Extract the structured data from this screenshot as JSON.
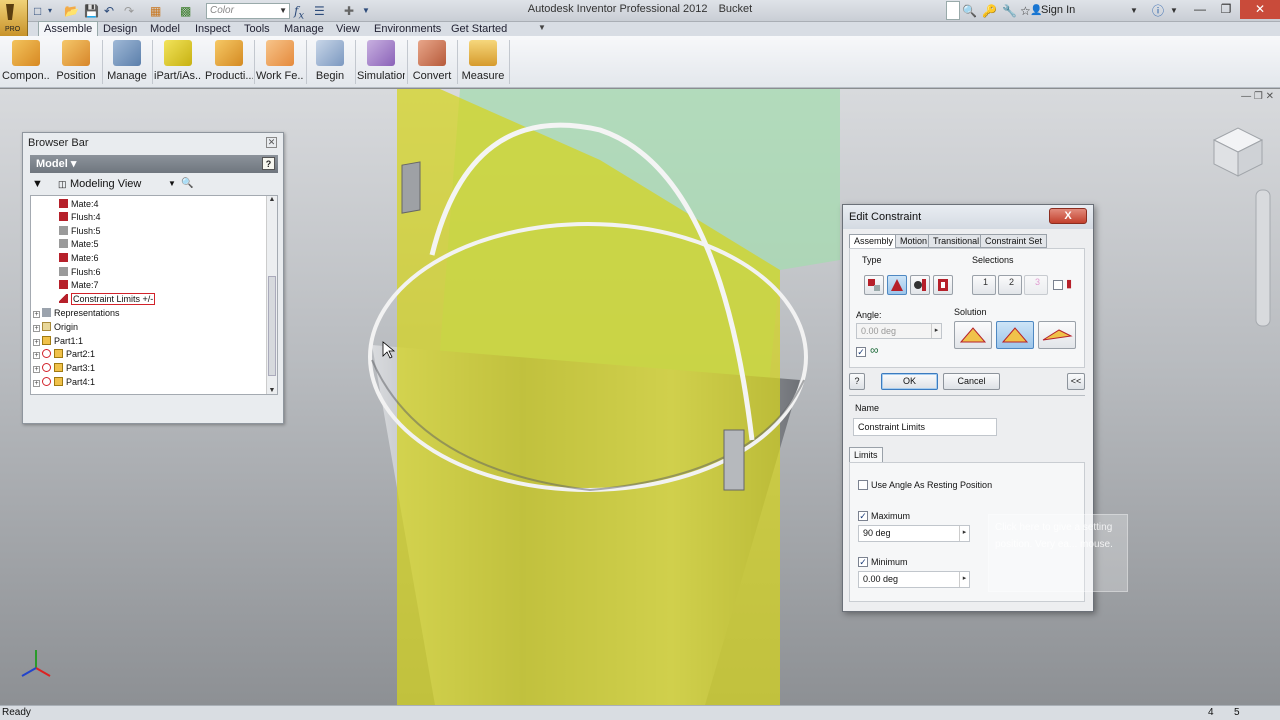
{
  "window": {
    "app_title": "Autodesk Inventor Professional 2012",
    "doc_title": "Bucket",
    "signin": "Sign In",
    "color_placeholder": "Color"
  },
  "app_button": {
    "badge": "PRO"
  },
  "menu_tabs": [
    {
      "label": "Assemble",
      "active": true
    },
    {
      "label": "Design"
    },
    {
      "label": "Model"
    },
    {
      "label": "Inspect"
    },
    {
      "label": "Tools"
    },
    {
      "label": "Manage"
    },
    {
      "label": "View"
    },
    {
      "label": "Environments"
    },
    {
      "label": "Get Started"
    }
  ],
  "ribbon": [
    {
      "label": "Compon...",
      "icon": "component-icon",
      "color": "#e8a33a"
    },
    {
      "label": "Position",
      "icon": "position-icon",
      "color": "#e8a33a"
    },
    {
      "label": "Manage",
      "icon": "manage-icon",
      "color": "#6e8fb8"
    },
    {
      "label": "iPart/iAs...",
      "icon": "ipart-icon",
      "color": "#d8c21a"
    },
    {
      "label": "Producti...",
      "icon": "productivity-icon",
      "color": "#e8a33a"
    },
    {
      "label": "Work Fe...",
      "icon": "work-features-icon",
      "color": "#f0a060"
    },
    {
      "label": "Begin",
      "icon": "begin-icon",
      "color": "#8aa6c9"
    },
    {
      "label": "Simulation",
      "icon": "simulation-icon",
      "color": "#9a72c0"
    },
    {
      "label": "Convert",
      "icon": "convert-icon",
      "color": "#c46a4a"
    },
    {
      "label": "Measure",
      "icon": "measure-icon",
      "color": "#d9a23a"
    }
  ],
  "browser": {
    "title": "Browser Bar",
    "model_label": "Model ▾",
    "help": "?",
    "view_label": "Modeling View",
    "tree": [
      {
        "label": "Mate:4",
        "indent": 2,
        "type": "mate"
      },
      {
        "label": "Flush:4",
        "indent": 2,
        "type": "flush"
      },
      {
        "label": "Flush:5",
        "indent": 2,
        "type": "flush"
      },
      {
        "label": "Mate:5",
        "indent": 2,
        "type": "mate"
      },
      {
        "label": "Mate:6",
        "indent": 2,
        "type": "mate"
      },
      {
        "label": "Flush:6",
        "indent": 2,
        "type": "flush"
      },
      {
        "label": "Mate:7",
        "indent": 2,
        "type": "mate"
      },
      {
        "label": "Constraint Limits +/-",
        "indent": 2,
        "type": "angle",
        "selected": true
      },
      {
        "label": "Representations",
        "indent": 0,
        "type": "folder",
        "expand": true
      },
      {
        "label": "Origin",
        "indent": 0,
        "type": "origin",
        "expand": true
      },
      {
        "label": "Part1:1",
        "indent": 0,
        "type": "part-grounded",
        "expand": true
      },
      {
        "label": "Part2:1",
        "indent": 0,
        "type": "part",
        "expand": true
      },
      {
        "label": "Part3:1",
        "indent": 0,
        "type": "part",
        "expand": true
      },
      {
        "label": "Part4:1",
        "indent": 0,
        "type": "part",
        "expand": true
      }
    ]
  },
  "dialog": {
    "title": "Edit Constraint",
    "close": "X",
    "tabs": [
      "Assembly",
      "Motion",
      "Transitional",
      "Constraint Set"
    ],
    "type_label": "Type",
    "selections_label": "Selections",
    "sel1": "1",
    "sel2": "2",
    "sel3": "3",
    "angle_label": "Angle:",
    "angle_value": "0.00 deg",
    "solution_label": "Solution",
    "ok": "OK",
    "cancel": "Cancel",
    "expand": "<<",
    "help": "?",
    "name_label": "Name",
    "name_value": "Constraint Limits",
    "limits_tab": "Limits",
    "resting_label": "Use Angle As Resting Position",
    "maximum_label": "Maximum",
    "maximum_value": "90 deg",
    "minimum_label": "Minimum",
    "minimum_value": "0.00 deg"
  },
  "ghost_tip": "Click here to give a setting position. Very ea... mouse.",
  "status": {
    "text": "Ready",
    "n1": "4",
    "n2": "5"
  },
  "colors": {
    "plane_yellow": "#d4d41e",
    "plane_green": "#9ed6a6",
    "accent": "#3b7bbf"
  }
}
